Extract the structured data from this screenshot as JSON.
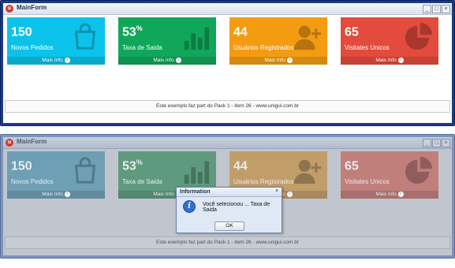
{
  "window": {
    "title": "MainForm",
    "minimize": "_",
    "restore": "□",
    "close": "×"
  },
  "tiles": [
    {
      "number": "150",
      "suffix": "",
      "label": "Novos Pedidos",
      "link": "Mais Info"
    },
    {
      "number": "53",
      "suffix": "%",
      "label": "Taxa de Saida",
      "link": "Mais Info"
    },
    {
      "number": "44",
      "suffix": "",
      "label": "Usuários Registrados",
      "link": "Mais Info"
    },
    {
      "number": "65",
      "suffix": "",
      "label": "Visitates Unicos",
      "link": "Mais Info"
    }
  ],
  "tile_colors": [
    "#0bc3ea",
    "#11a75a",
    "#f39c12",
    "#e34b3d"
  ],
  "footer_text": "Este exemplo faz part do Pack 1 - item 26 - www.unigui.com.br",
  "dialog": {
    "title": "Information",
    "close": "×",
    "message": "Você selecionou ... Taxa de Saida",
    "ok_label": "OK"
  }
}
